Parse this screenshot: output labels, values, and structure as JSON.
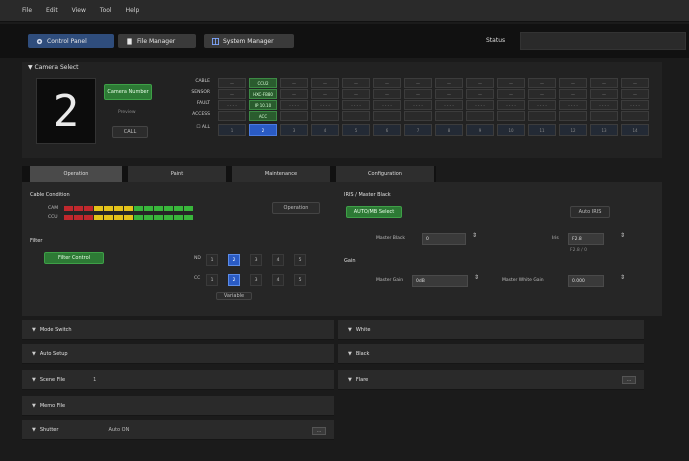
{
  "menubar": {
    "items": [
      "File",
      "Edit",
      "View",
      "Tool",
      "Help"
    ]
  },
  "tabs": [
    {
      "label": "Control Panel",
      "icon": "gear-icon",
      "active": true
    },
    {
      "label": "File Manager",
      "icon": "document-icon",
      "active": false
    },
    {
      "label": "System Manager",
      "icon": "grid-icon",
      "active": false
    }
  ],
  "status": {
    "label": "Status",
    "value": ""
  },
  "camera_select": {
    "header": "Camera Select",
    "current_number": "2",
    "camera_button": "Camera Number",
    "preview_label": "Preview",
    "call_label": "CALL",
    "row_labels": [
      "CABLE",
      "SENSOR",
      "FAULT",
      "ACCESS",
      "ALL"
    ],
    "cable_cells": [
      "—",
      "CCU2",
      "—",
      "—",
      "—",
      "—",
      "—",
      "—",
      "—",
      "—",
      "—",
      "—",
      "—",
      "—"
    ],
    "sensor_cells": [
      "—",
      "HXC-FB80",
      "—",
      "—",
      "—",
      "—",
      "—",
      "—",
      "—",
      "—",
      "—",
      "—",
      "—",
      "—"
    ],
    "fault_cells": [
      "- - - -",
      "IP 10.10",
      "- - - -",
      "- - - -",
      "- - - -",
      "- - - -",
      "- - - -",
      "- - - -",
      "- - - -",
      "- - - -",
      "- - - -",
      "- - - -",
      "- - - -",
      "- - - -"
    ],
    "access_cells": [
      "",
      "ACC",
      "",
      "",
      "",
      "",
      "",
      "",
      "",
      "",
      "",
      "",
      "",
      ""
    ],
    "all_cells": [
      "1",
      "2",
      "3",
      "4",
      "5",
      "6",
      "7",
      "8",
      "9",
      "10",
      "11",
      "12",
      "13",
      "14"
    ],
    "selected_index": 1
  },
  "subtabs": [
    {
      "label": "Operation",
      "active": true
    },
    {
      "label": "Paint",
      "active": false
    },
    {
      "label": "Maintenance",
      "active": false
    },
    {
      "label": "Configuration",
      "active": false
    }
  ],
  "operation": {
    "cable_condition": {
      "header": "Cable Condition",
      "label_cam": "CAM",
      "label_ccu": "CCU",
      "operation_button": "Operation"
    },
    "filter": {
      "header": "Filter",
      "filter_button": "Filter Control",
      "nd_label": "ND",
      "cc_label": "CC",
      "values": [
        "1",
        "2",
        "3",
        "4",
        "5"
      ],
      "nd_selected": 2,
      "cc_selected": 2,
      "auto_label": "Variable"
    },
    "iris_master_black": {
      "header": "IRIS / Master Black",
      "toggle_button": "AUTO/MB Select",
      "auto_iris_button": "Auto IRIS",
      "master_black_label": "Master Black",
      "master_black_value": "0",
      "iris_label": "Iris",
      "iris_value": "F2.8",
      "iris_sub": "F2.8 / 0",
      "gain_header": "Gain",
      "master_gain_label": "Master Gain",
      "master_gain_value": "0dB",
      "white_gain_label": "Master White Gain",
      "white_gain_value": "0.000"
    }
  },
  "accordion_left": [
    {
      "label": "Mode Switch",
      "extra": ""
    },
    {
      "label": "Auto Setup",
      "extra": ""
    },
    {
      "label": "Scene File",
      "extra": "1"
    },
    {
      "label": "Memo File",
      "extra": ""
    },
    {
      "label": "Shutter",
      "extra": "Auto  ON"
    }
  ],
  "accordion_right": [
    {
      "label": "White",
      "extra": ""
    },
    {
      "label": "Black",
      "extra": ""
    },
    {
      "label": "Flare",
      "extra": ""
    }
  ],
  "colors": {
    "accent_blue": "#2f4d7c",
    "green": "#2d7a35",
    "meter_red": "#c0282d",
    "meter_yellow": "#e4c21a",
    "meter_green": "#39b63b"
  }
}
